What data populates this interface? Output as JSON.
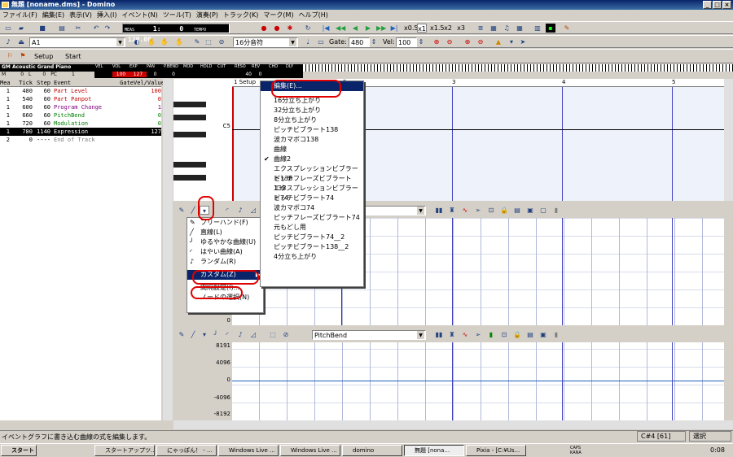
{
  "window": {
    "title": "無題 [noname.dms] - Domino"
  },
  "menubar": [
    "ファイル(F)",
    "編集(E)",
    "表示(V)",
    "挿入(I)",
    "イベント(N)",
    "ツール(T)",
    "演奏(P)",
    "トラック(K)",
    "マーク(M)",
    "ヘルプ(H)"
  ],
  "toolbar1": {
    "meas_label": "MEAS",
    "meas_value": "1:",
    "tick_value": "0",
    "tempo_label": "TEMPO",
    "tempo_value": "120.00",
    "zoom": [
      "x0.5",
      "x1",
      "x1.5",
      "x2",
      "x3"
    ]
  },
  "toolbar2": {
    "track": "A1",
    "note_length": "16分音符",
    "gate_label": "Gate:",
    "gate_value": "480",
    "vel_label": "Vel:",
    "vel_value": "100"
  },
  "toolbar3": {
    "setup": "Setup",
    "start": "Start"
  },
  "mixer": {
    "instrument": "GM Acoustic Grand Piano",
    "labels": [
      "VEL",
      "VOL",
      "EXP",
      "PAN",
      "P.BEND",
      "MOD",
      "HOLD",
      "CUT",
      "RESO",
      "REV",
      "CHO",
      "DLY"
    ],
    "m_label": "M",
    "m_value": "0",
    "l_label": "L",
    "l_value": "0",
    "pc_label": "PC",
    "pc_value": "1",
    "values": [
      "100",
      "127",
      "0",
      "0",
      "40",
      "0"
    ]
  },
  "event_table": {
    "headers": [
      "Mea",
      "Tick",
      "Step",
      "Event",
      "Gate",
      "Vel/Value"
    ],
    "rows": [
      {
        "mea": "1",
        "tick": "480",
        "step": "60",
        "event": "Part Level",
        "gate": "",
        "value": "100",
        "color": "#c00000"
      },
      {
        "mea": "1",
        "tick": "540",
        "step": "60",
        "event": "Part Panpot",
        "gate": "",
        "value": "0",
        "color": "#c00000"
      },
      {
        "mea": "1",
        "tick": "600",
        "step": "60",
        "event": "Program Change",
        "gate": "",
        "value": "1",
        "color": "#800080"
      },
      {
        "mea": "1",
        "tick": "660",
        "step": "60",
        "event": "PitchBend",
        "gate": "",
        "value": "0",
        "color": "#008000"
      },
      {
        "mea": "1",
        "tick": "720",
        "step": "60",
        "event": "Modulation",
        "gate": "",
        "value": "0",
        "color": "#008000"
      },
      {
        "mea": "1",
        "tick": "780",
        "step": "1140",
        "event": "Expression",
        "gate": "",
        "value": "127",
        "color": "#ffffff"
      },
      {
        "mea": "2",
        "tick": "0",
        "step": "----",
        "event": "End of Track",
        "gate": "",
        "value": "",
        "color": "#808080"
      }
    ]
  },
  "piano_roll": {
    "measures": [
      "1 Setup",
      "2",
      "3",
      "4",
      "5"
    ],
    "c5_label": "C5"
  },
  "custom_menu": {
    "items": [
      "編集(E)...",
      "16分立ち上がり",
      "32分立ち上がり",
      "8分立ち上がり",
      "ピッチビブラート138",
      "波カマボコ138",
      "曲線",
      "曲線2",
      "エクスプレッションビブラート138",
      "ピッチフレーズビブラート138",
      "エクスプレッションビブラート74",
      "ピッチビブラート74",
      "波カマボコ74",
      "ピッチフレーズビブラート74",
      "元もどし用",
      "ピッチビブラート74__2",
      "ピッチビブラート138__2",
      "4分立ち上がり"
    ],
    "checked_index": 7
  },
  "tool_menu": {
    "items": [
      "フリーハンド(F)",
      "直線(L)",
      "ゆるやかな曲線(U)",
      "はやい曲線(A)",
      "ランダム(R)",
      "カスタム(Z)",
      "間隔設定(I)...",
      "ノードの選択(N)"
    ],
    "highlight_index": 5
  },
  "controller_lower": {
    "select_value": "PitchBend",
    "y_labels": [
      "8191",
      "4096",
      "0",
      "-4096",
      "-8192"
    ]
  },
  "controller_upper": {
    "y_label_zero": "0"
  },
  "status": {
    "message": "イベントグラフに書き込む曲線の式を編集します。",
    "position": "C#4 [61]",
    "mode": "選択"
  },
  "taskbar": {
    "start": "スタート",
    "tasks": [
      "スタートアップツ...",
      "にゃっぽん！ - ...",
      "Windows Live ...",
      "Windows Live ...",
      "domino",
      "無題 [nona...",
      "Pixia - [C:¥Us..."
    ],
    "clock": "0:08",
    "caps": "CAPS",
    "kana": "KANA"
  }
}
